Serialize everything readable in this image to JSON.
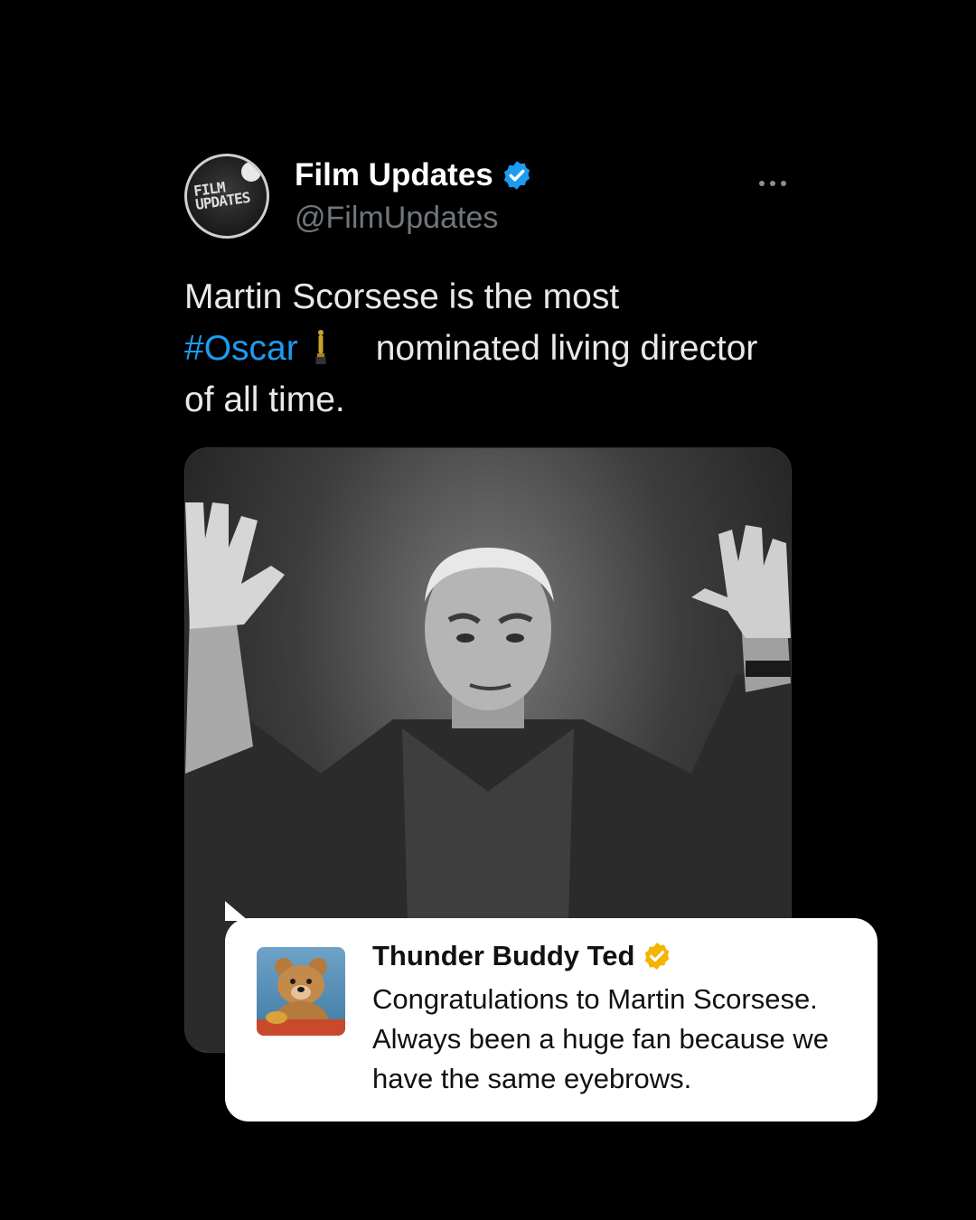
{
  "tweet": {
    "display_name": "Film Updates",
    "handle": "@FilmUpdates",
    "avatar_text_line1": "FILM",
    "avatar_text_line2": "UPDATES",
    "verified_color": "#1d9bf0",
    "text_part1": "Martin Scorsese is the most",
    "hashtag": "#Oscar",
    "text_part2": "nominated living director of all time.",
    "more_icon": "ellipsis-icon",
    "oscar_icon": "oscar-statuette-icon"
  },
  "reply": {
    "display_name": "Thunder Buddy Ted",
    "verified_color": "#f4b400",
    "text": "Congratulations to Martin Scorsese. Always been a huge fan because we have the same eyebrows."
  },
  "colors": {
    "background": "#000000",
    "hashtag": "#1d9bf0",
    "handle": "#71767b"
  }
}
